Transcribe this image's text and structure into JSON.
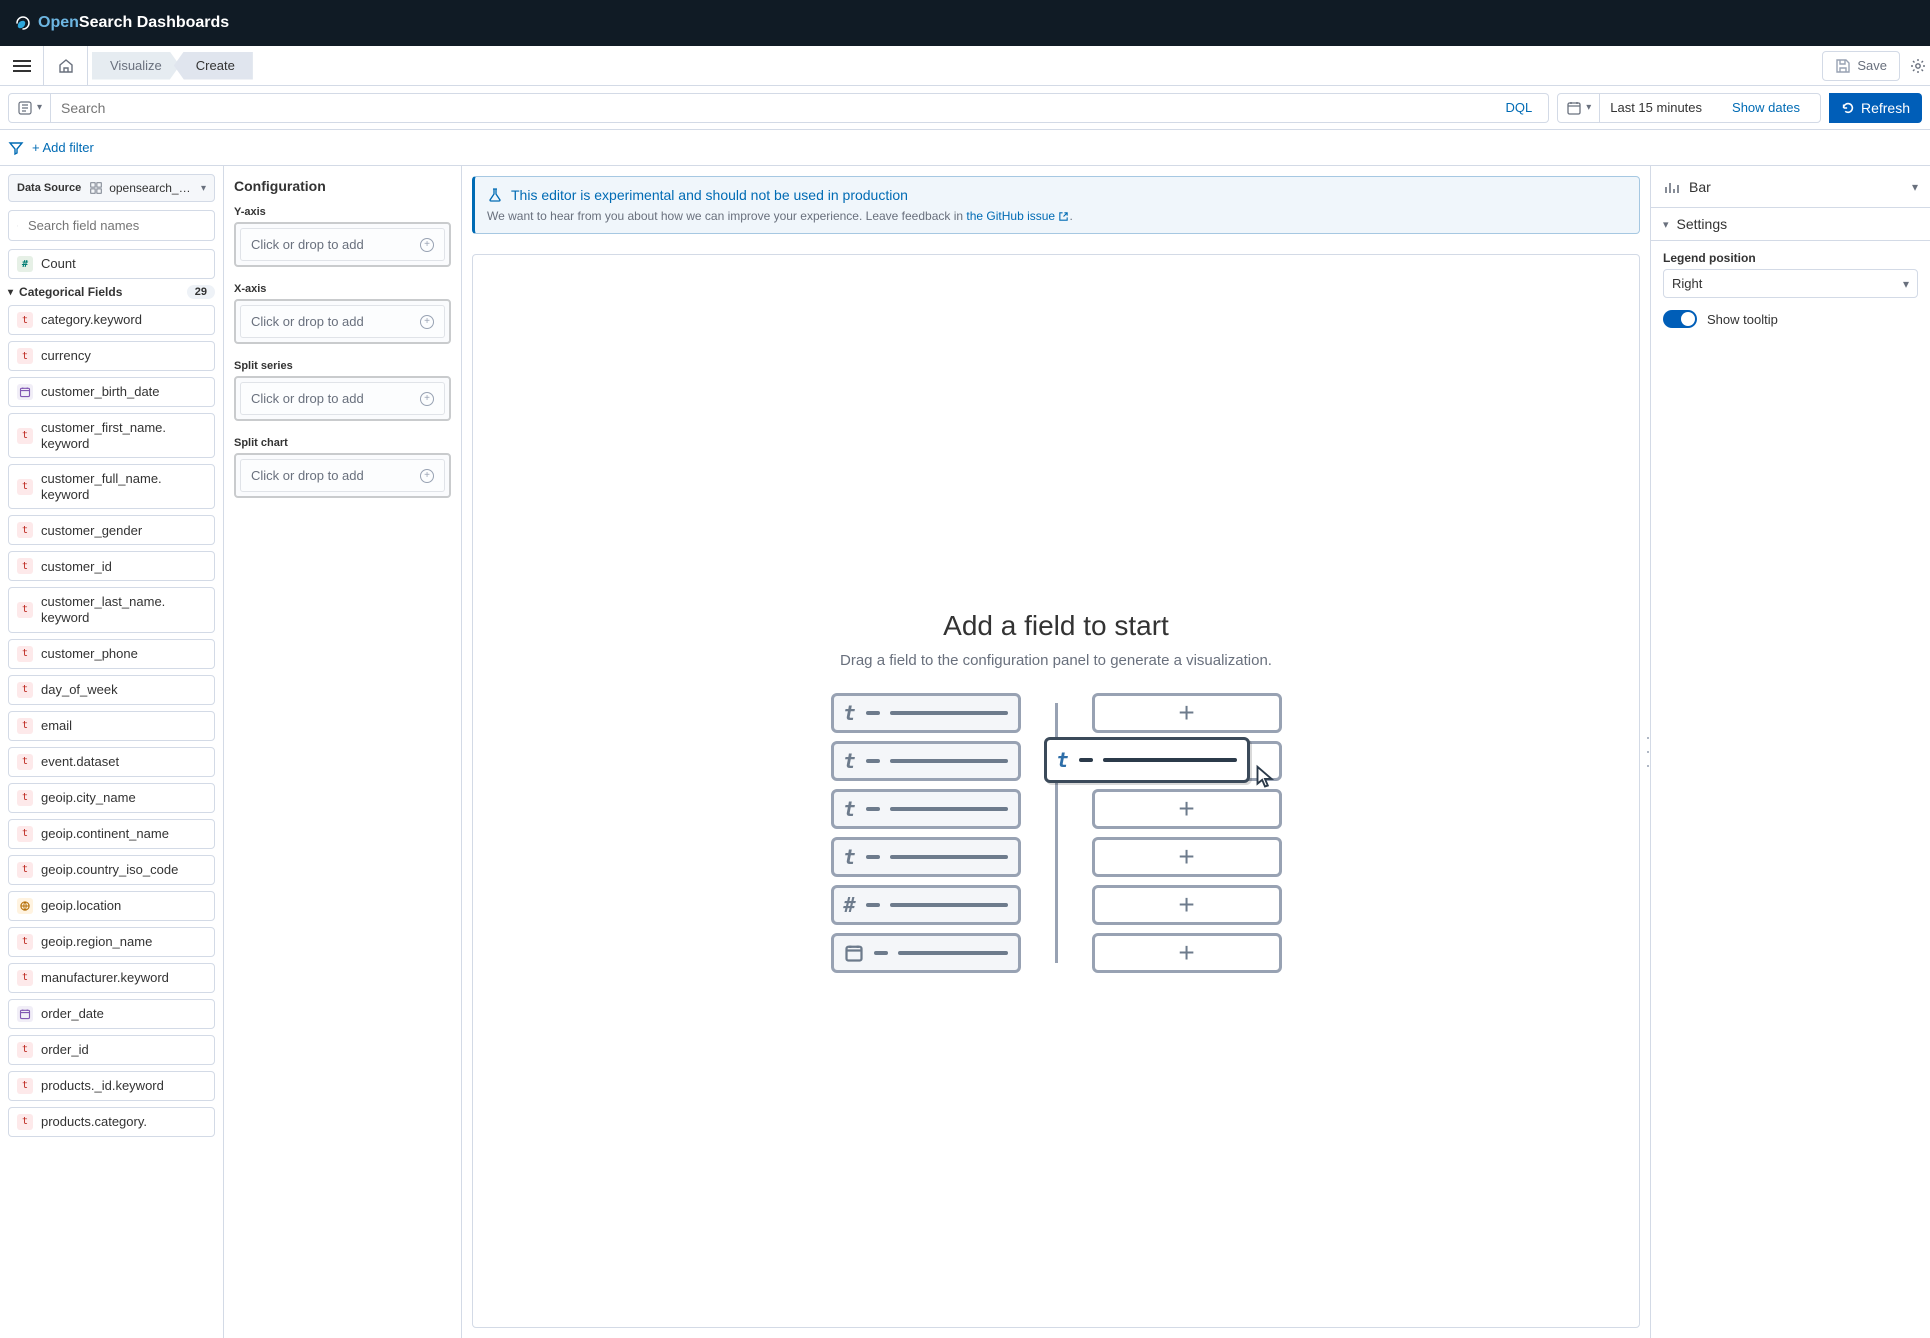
{
  "product": {
    "name": "OpenSearch Dashboards",
    "brand_accent": "Open",
    "brand_rest": "Search"
  },
  "breadcrumbs": {
    "prev": "Visualize",
    "current": "Create"
  },
  "actions": {
    "save": "Save",
    "refresh": "Refresh"
  },
  "search": {
    "placeholder": "Search",
    "language": "DQL"
  },
  "time": {
    "range": "Last 15 minutes",
    "show_dates": "Show dates"
  },
  "filters": {
    "add": "+ Add filter"
  },
  "datasource": {
    "label": "Data Source",
    "value": "opensearch_dashboards_sample_data_ec…"
  },
  "field_search": {
    "placeholder": "Search field names"
  },
  "count_field": {
    "label": "Count",
    "type": "n"
  },
  "categorical": {
    "label": "Categorical Fields",
    "count": "29",
    "items": [
      {
        "t": "t",
        "n": "category.keyword"
      },
      {
        "t": "t",
        "n": "currency"
      },
      {
        "t": "d",
        "n": "customer_birth_date"
      },
      {
        "t": "t",
        "n": "customer_first_name.keyword"
      },
      {
        "t": "t",
        "n": "customer_full_name.keyword"
      },
      {
        "t": "t",
        "n": "customer_gender"
      },
      {
        "t": "t",
        "n": "customer_id"
      },
      {
        "t": "t",
        "n": "customer_last_name.keyword"
      },
      {
        "t": "t",
        "n": "customer_phone"
      },
      {
        "t": "t",
        "n": "day_of_week"
      },
      {
        "t": "t",
        "n": "email"
      },
      {
        "t": "t",
        "n": "event.dataset"
      },
      {
        "t": "t",
        "n": "geoip.city_name"
      },
      {
        "t": "t",
        "n": "geoip.continent_name"
      },
      {
        "t": "t",
        "n": "geoip.country_iso_code"
      },
      {
        "t": "g",
        "n": "geoip.location"
      },
      {
        "t": "t",
        "n": "geoip.region_name"
      },
      {
        "t": "t",
        "n": "manufacturer.keyword"
      },
      {
        "t": "d",
        "n": "order_date"
      },
      {
        "t": "t",
        "n": "order_id"
      },
      {
        "t": "t",
        "n": "products._id.keyword"
      },
      {
        "t": "t",
        "n": "products.category."
      }
    ]
  },
  "config": {
    "title": "Configuration",
    "yaxis": {
      "label": "Y-axis",
      "placeholder": "Click or drop to add"
    },
    "xaxis": {
      "label": "X-axis",
      "placeholder": "Click or drop to add"
    },
    "split_series": {
      "label": "Split series",
      "placeholder": "Click or drop to add"
    },
    "split_chart": {
      "label": "Split chart",
      "placeholder": "Click or drop to add"
    }
  },
  "callout": {
    "title": "This editor is experimental and should not be used in production",
    "subtitle_pre": "We want to hear from you about how we can improve your experience. Leave feedback in ",
    "subtitle_link": "the GitHub issue",
    "subtitle_post": "."
  },
  "empty_state": {
    "heading": "Add a field to start",
    "sub": "Drag a field to the configuration panel to generate a visualization."
  },
  "settings": {
    "vis_type": "Bar",
    "heading": "Settings",
    "legend_label": "Legend position",
    "legend_value": "Right",
    "tooltip_label": "Show tooltip"
  }
}
